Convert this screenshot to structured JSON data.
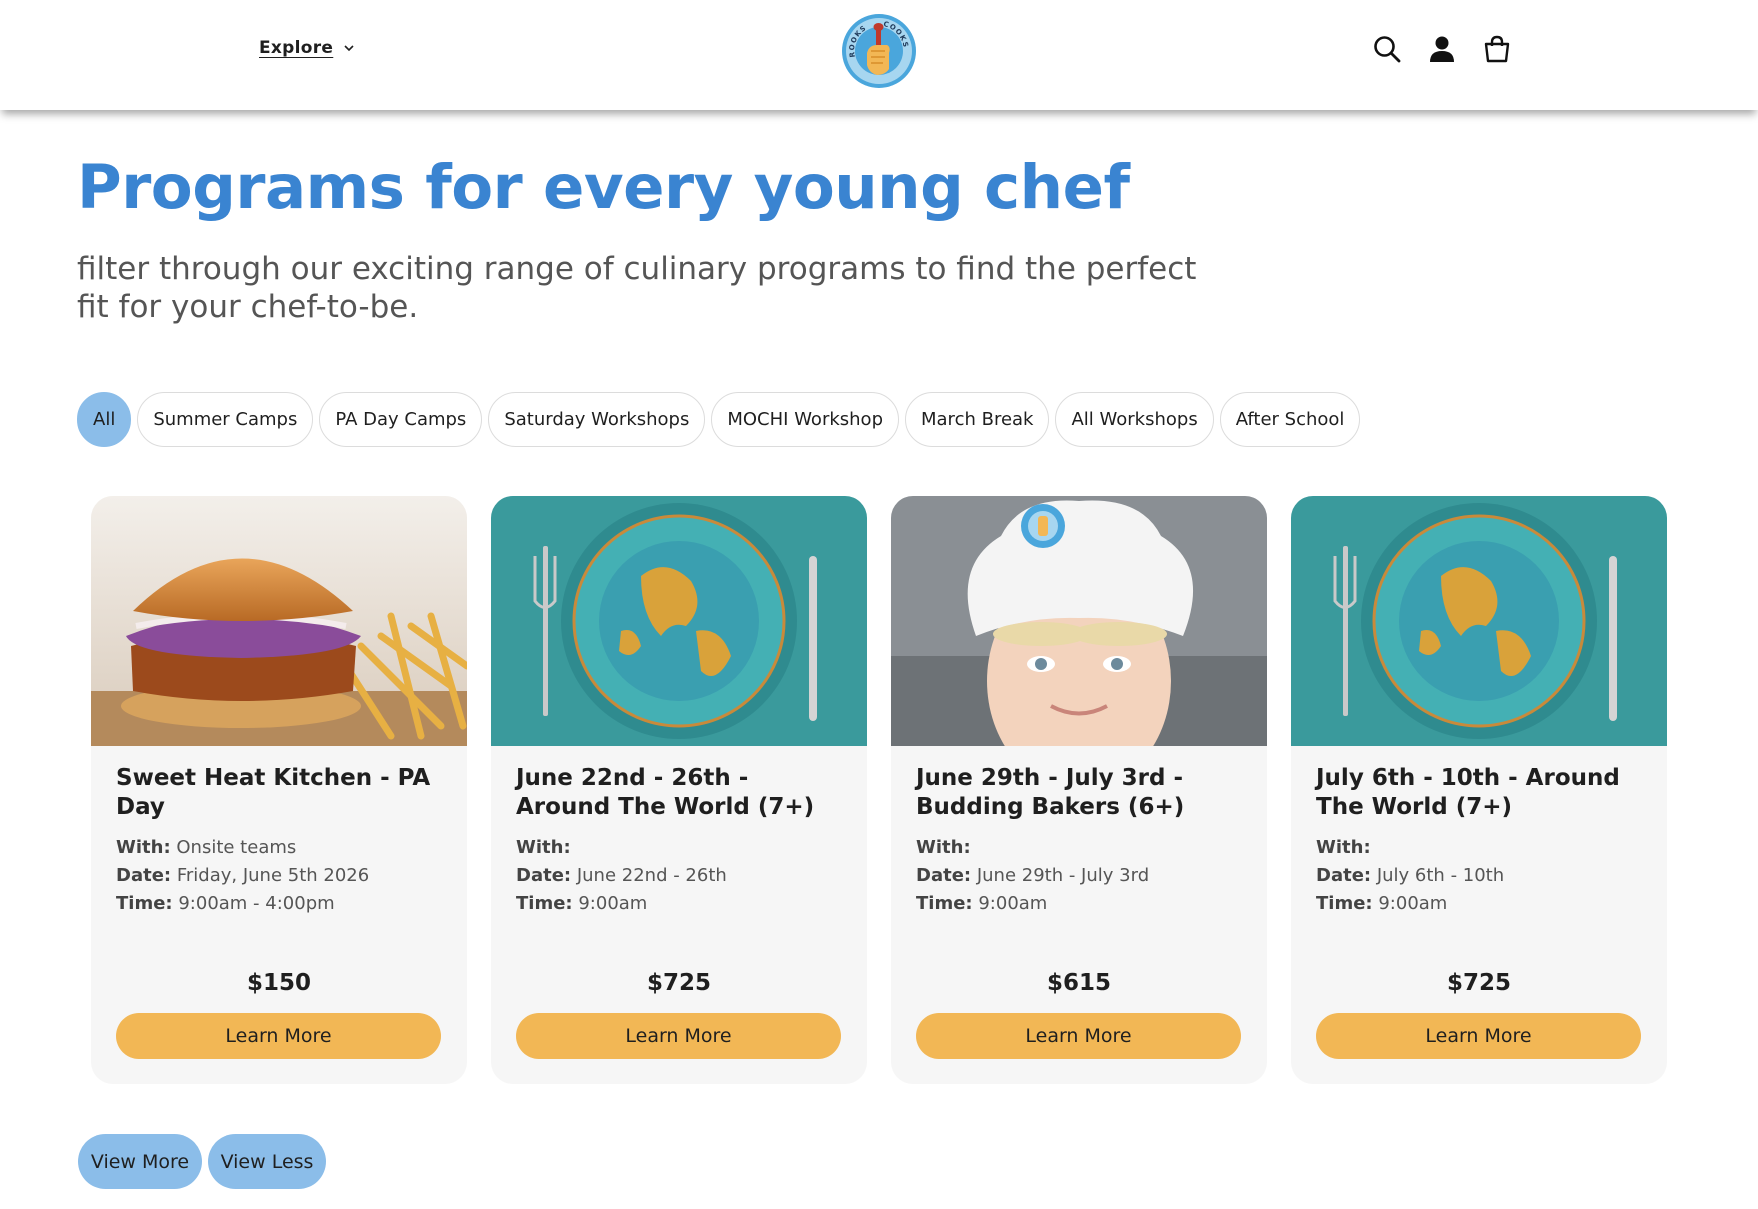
{
  "header": {
    "explore_label": "Explore",
    "logo_text_left": "ROOKS",
    "logo_text_right": "COOKS",
    "icons": [
      "search-icon",
      "account-icon",
      "cart-icon"
    ]
  },
  "hero": {
    "title": "Programs for every young chef",
    "subtitle": "filter through our exciting range of culinary programs to find the perfect fit for your chef-to-be."
  },
  "filters": [
    {
      "label": "All",
      "active": true
    },
    {
      "label": "Summer Camps",
      "active": false
    },
    {
      "label": "PA Day Camps",
      "active": false
    },
    {
      "label": "Saturday Workshops",
      "active": false
    },
    {
      "label": "MOCHI Workshop",
      "active": false
    },
    {
      "label": "March Break",
      "active": false
    },
    {
      "label": "All Workshops",
      "active": false
    },
    {
      "label": "After School",
      "active": false
    }
  ],
  "cards": [
    {
      "title": "Sweet Heat Kitchen - PA Day",
      "with_label": "With:",
      "with_value": " Onsite teams",
      "date_label": "Date:",
      "date_value": " Friday, June 5th 2026",
      "time_label": "Time:",
      "time_value": " 9:00am - 4:00pm",
      "price": "$150",
      "button": "Learn More",
      "image": "burger-and-fries-photo"
    },
    {
      "title": "June 22nd - 26th - Around The World (7+)",
      "with_label": "With:",
      "with_value": "",
      "date_label": "Date:",
      "date_value": " June 22nd - 26th",
      "time_label": "Time:",
      "time_value": " 9:00am",
      "price": "$725",
      "button": "Learn More",
      "image": "globe-on-plate-photo"
    },
    {
      "title": "June 29th - July 3rd - Budding Bakers (6+)",
      "with_label": "With:",
      "with_value": "",
      "date_label": "Date:",
      "date_value": " June 29th - July 3rd",
      "time_label": "Time:",
      "time_value": " 9:00am",
      "price": "$615",
      "button": "Learn More",
      "image": "child-in-chef-hat-photo"
    },
    {
      "title": "July 6th - 10th - Around The World (7+)",
      "with_label": "With:",
      "with_value": "",
      "date_label": "Date:",
      "date_value": " July 6th - 10th",
      "time_label": "Time:",
      "time_value": " 9:00am",
      "price": "$725",
      "button": "Learn More",
      "image": "globe-on-plate-photo"
    }
  ],
  "footer_buttons": {
    "view_more": "View More",
    "view_less": "View Less"
  },
  "colors": {
    "title_blue": "#3a84d1",
    "chip_active": "#8bbde9",
    "button_orange": "#f2b755",
    "card_bg": "#f6f6f6"
  }
}
